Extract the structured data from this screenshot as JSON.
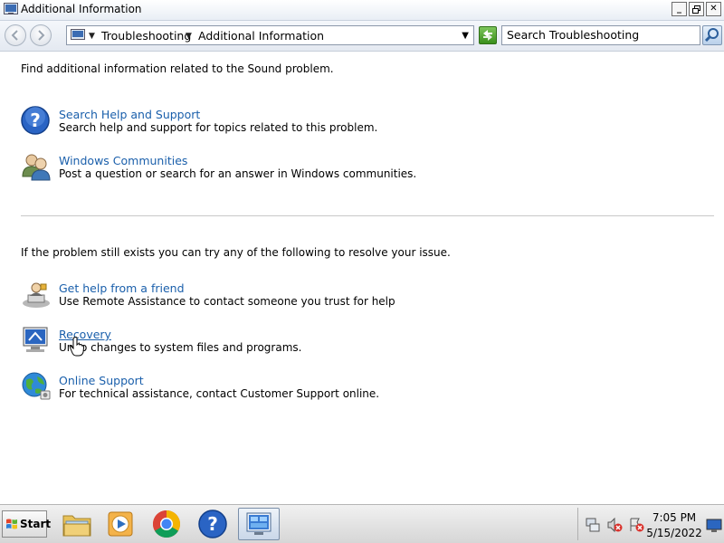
{
  "window": {
    "title": "Additional Information"
  },
  "navigation": {
    "crumb_1": "Troubleshooting",
    "crumb_2": "Additional Information",
    "search_placeholder": "Search Troubleshooting"
  },
  "content": {
    "intro": "Find additional information related to the Sound problem.",
    "items_top": [
      {
        "link": "Search Help and Support",
        "description": "Search help and support for topics related to this problem.",
        "icon": "help-icon"
      },
      {
        "link": "Windows Communities",
        "description": "Post a question or search for an answer in Windows communities.",
        "icon": "people-icon"
      }
    ],
    "intro_2": "If the problem still exists you can try any of the following to resolve your issue.",
    "items_bottom": [
      {
        "link": "Get help from a friend",
        "description": "Use Remote Assistance to contact someone you trust for help",
        "icon": "remote-assistance-icon"
      },
      {
        "link": "Recovery",
        "description": "Undo changes to system files and programs.",
        "icon": "recovery-icon"
      },
      {
        "link": "Online Support",
        "description": "For technical assistance, contact Customer Support online.",
        "icon": "globe-icon"
      }
    ]
  },
  "taskbar": {
    "start_label": "Start",
    "time": "7:05 PM",
    "date": "5/15/2022"
  }
}
